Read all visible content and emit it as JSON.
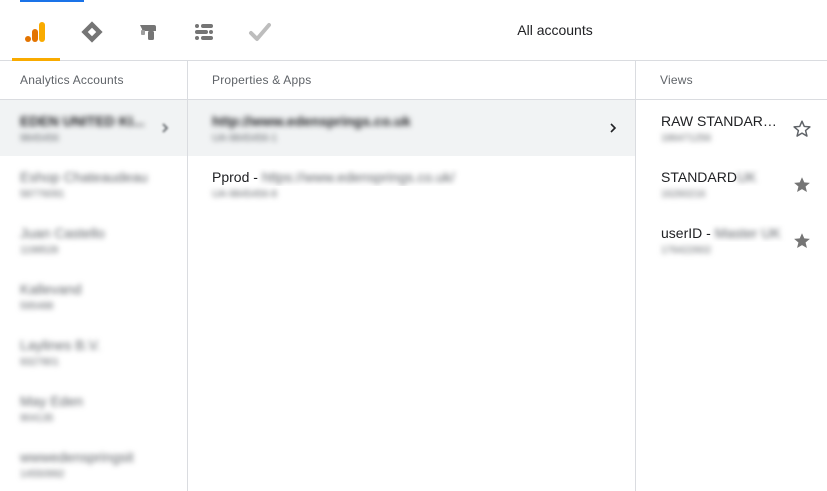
{
  "header": {
    "title": "All accounts",
    "products": [
      {
        "name": "analytics",
        "icon": "analytics-icon",
        "active": true
      },
      {
        "name": "tag-manager",
        "icon": "tag-manager-icon",
        "active": false
      },
      {
        "name": "optimize",
        "icon": "optimize-icon",
        "active": false
      },
      {
        "name": "data-studio",
        "icon": "data-studio-icon",
        "active": false
      },
      {
        "name": "surveys",
        "icon": "checkmark-icon",
        "active": false
      }
    ],
    "accent_color": "#f9ab00"
  },
  "columns": {
    "accounts": {
      "header": "Analytics Accounts",
      "items": [
        {
          "title": "EDEN UNITED KI...",
          "sub": "9845456",
          "selected": true
        },
        {
          "title": "Eshop Chateaudeau",
          "sub": "58776091"
        },
        {
          "title": "Juan Castello",
          "sub": "1198528"
        },
        {
          "title": "Kallevand",
          "sub": "595488"
        },
        {
          "title": "Laylines B.V.",
          "sub": "9327801"
        },
        {
          "title": "May Eden",
          "sub": "904135"
        },
        {
          "title": "wwwedenspringsit",
          "sub": "14550992"
        }
      ]
    },
    "properties": {
      "header": "Properties & Apps",
      "items": [
        {
          "title": "http://www.edensprings.co.uk",
          "sub": "UA-9845456-1",
          "selected": true
        },
        {
          "title_prefix": "Pprod - ",
          "title": "https://www.edensprings.co.uk/",
          "sub": "UA-9845456-8"
        }
      ]
    },
    "views": {
      "header": "Views",
      "items": [
        {
          "title": "RAW STANDARD ...",
          "sub": "186471256",
          "starred": false
        },
        {
          "title": "STANDARD",
          "title_suffix": " UK",
          "sub": "16260216",
          "starred": true
        },
        {
          "title": "userID - ",
          "title_suffix": "Master UK",
          "sub": "176422602",
          "starred": true
        }
      ]
    }
  }
}
